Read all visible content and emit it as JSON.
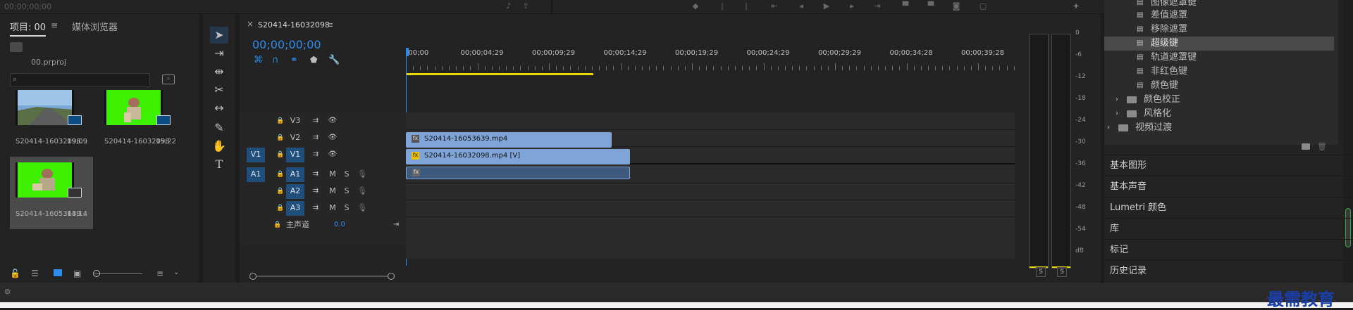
{
  "topbar": {
    "timecode": "00;00;00;00"
  },
  "project": {
    "tab_project": "项目: 00",
    "tab_browser": "媒体浏览器",
    "file_name": "00.prproj",
    "items": [
      {
        "name": "S20414-16032098...",
        "duration": "19;09"
      },
      {
        "name": "S20414-16032098",
        "duration": "15;22"
      },
      {
        "name": "S20414-16053639...",
        "duration": "14;14"
      }
    ]
  },
  "timeline": {
    "sequence_name": "S20414-16032098",
    "playhead_time": "00;00;00;00",
    "ruler_labels": [
      ";00;00",
      "00;00;04;29",
      "00;00;09;29",
      "00;00;14;29",
      "00;00;19;29",
      "00;00;24;29",
      "00;00;29;29",
      "00;00;34;28",
      "00;00;39;28"
    ],
    "tracks": [
      {
        "id": "V3",
        "type": "video"
      },
      {
        "id": "V2",
        "type": "video"
      },
      {
        "id": "V1",
        "type": "video",
        "source": "V1"
      },
      {
        "id": "A1",
        "type": "audio",
        "source": "A1",
        "m": "M",
        "s": "S"
      },
      {
        "id": "A2",
        "type": "audio",
        "m": "M",
        "s": "S"
      },
      {
        "id": "A3",
        "type": "audio",
        "m": "M",
        "s": "S"
      }
    ],
    "master": {
      "label": "主声道",
      "value": "0.0"
    },
    "clips": {
      "v2": "S20414-16053639.mp4",
      "v1": "S20414-16032098.mp4 [V]"
    }
  },
  "meter": {
    "scale": [
      "0",
      "-6",
      "-12",
      "-18",
      "-24",
      "-30",
      "-36",
      "-42",
      "-48",
      "-54",
      "dB"
    ],
    "solo_left": "S",
    "solo_right": "S"
  },
  "effects": {
    "items": [
      "图像遮罩键",
      "差值遮罩",
      "移除遮罩",
      "超级键",
      "轨道遮罩键",
      "非红色键",
      "颜色键"
    ],
    "folders": [
      "颜色校正",
      "风格化"
    ],
    "root_folder": "视频过渡",
    "selected": "超级键"
  },
  "panels": [
    "基本图形",
    "基本声音",
    "Lumetri 颜色",
    "库",
    "标记",
    "历史记录"
  ],
  "watermark": "最需教育",
  "colors": {
    "accent_blue": "#2d8ceb",
    "clip_blue": "#7fa5d8",
    "track_target": "#1f4f7a",
    "green_screen": "#3cf000",
    "yellow_workarea": "#e8d700"
  }
}
